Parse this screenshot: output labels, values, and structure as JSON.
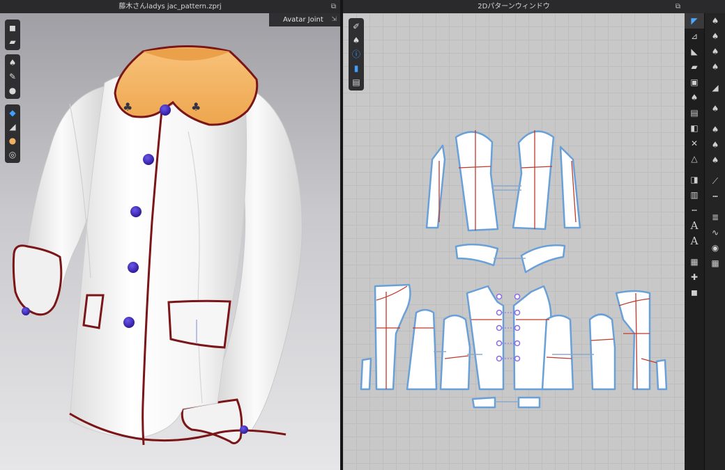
{
  "window3d": {
    "title": "藤木さんladys jac_pattern.zprj",
    "pin": "⧉",
    "avatar_joint_label": "Avatar Joint",
    "avatar_joint_pin": "⇲",
    "tools_group1": [
      "cube-icon",
      "shirt-fold-icon"
    ],
    "tools_group2": [
      "shirt-icon",
      "hanger-icon",
      "avatar-icon"
    ],
    "tools_group3": [
      "texture-icon",
      "pen-icon",
      "skin-icon",
      "globe-icon"
    ]
  },
  "window2d": {
    "title": "2Dパターンウィンドウ",
    "pin": "⧉",
    "tools": [
      "needle-icon",
      "shirt-icon",
      "info-icon",
      "book-icon",
      "layer-icon"
    ]
  },
  "right_toolbar_1": [
    "select-icon",
    "transform-icon",
    "edit-point-icon",
    "polygon-icon",
    "rectangle-icon",
    "internal-line-icon",
    "sewing-icon",
    "segment-icon",
    "free-sewing-icon",
    "line-icon",
    "fold-icon",
    "pin-icon",
    "measure-icon",
    "text-icon",
    "text-sub-icon",
    "grid-icon",
    "pin-tool-icon",
    "lock-icon"
  ],
  "right_toolbar_2": [
    "shirt-select-icon",
    "shirt-move-icon",
    "shirt-gear-icon",
    "shirt-sew-icon",
    "iron-icon",
    "tee-icon",
    "shirt-arrow-icon",
    "shirt-dots-icon",
    "shirt-grid-icon",
    "seam-icon",
    "stitch-icon",
    "zip-icon",
    "topstitch-icon",
    "button-icon",
    "buttonhole-icon"
  ],
  "colors": {
    "collar": "#f4b25f",
    "piping": "#7a1518",
    "button": "#3a24b8",
    "pattern_outline": "#6aa0d8",
    "pattern_line": "#c0392b"
  }
}
